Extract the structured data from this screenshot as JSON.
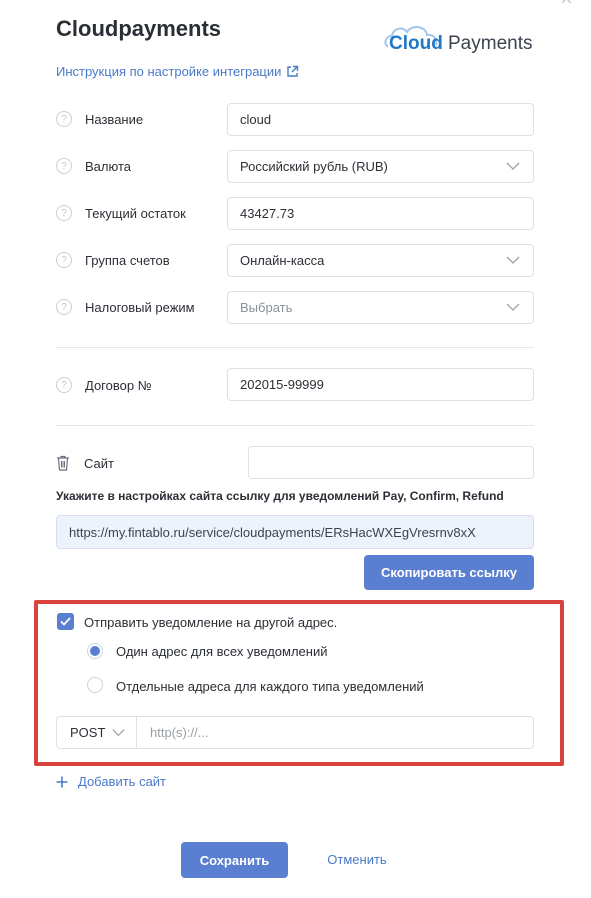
{
  "header": {
    "title": "Cloudpayments",
    "close_symbol": "×"
  },
  "logo": {
    "part1": "Cloud",
    "part2": "Payments"
  },
  "guide_link": "Инструкция по настройке интеграции",
  "fields": {
    "name": {
      "label": "Название",
      "value": "cloud"
    },
    "currency": {
      "label": "Валюта",
      "value": "Российский рубль (RUB)"
    },
    "balance": {
      "label": "Текущий остаток",
      "value": "43427.73"
    },
    "account_group": {
      "label": "Группа счетов",
      "value": "Онлайн-касса"
    },
    "tax_mode": {
      "label": "Налоговый режим",
      "placeholder": "Выбрать"
    },
    "contract": {
      "label": "Договор №",
      "value": "202015-99999"
    }
  },
  "site": {
    "label": "Сайт",
    "value": "",
    "hint": "Укажите в настройках сайта ссылку для уведомлений Pay, Confirm, Refund",
    "notify_url": "https://my.fintablo.ru/service/cloudpayments/ERsHacWXEgVresrnv8xX",
    "copy_button": "Скопировать ссылку"
  },
  "notify": {
    "checkbox_label": "Отправить уведомление на другой адрес.",
    "checked": true,
    "option_single": "Один адрес для всех уведомлений",
    "option_separate": "Отдельные адреса для каждого типа уведомлений",
    "selected_option": "single",
    "method": "POST",
    "url_placeholder": "http(s)://..."
  },
  "add_site": "Добавить сайт",
  "actions": {
    "save": "Сохранить",
    "cancel": "Отменить"
  },
  "colors": {
    "accent": "#5b7fd0",
    "link": "#4a79c9",
    "highlight_border": "#d9433d"
  }
}
